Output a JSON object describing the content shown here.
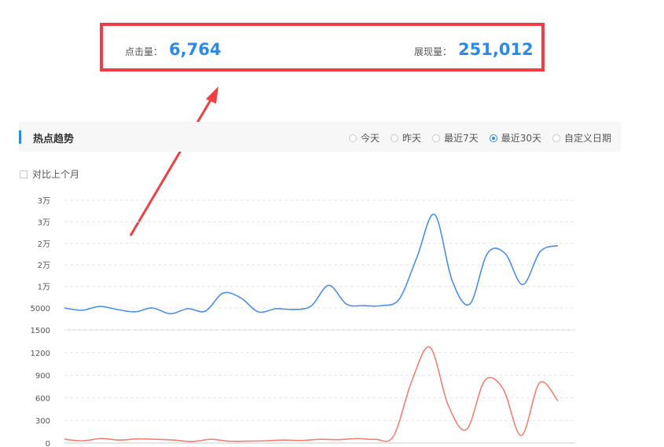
{
  "stats": {
    "clicks": {
      "label": "点击量：",
      "value": "6,764"
    },
    "impressions": {
      "label": "展现量：",
      "value": "251,012"
    }
  },
  "trend": {
    "title": "热点趋势",
    "ranges": [
      {
        "label": "今天",
        "checked": false
      },
      {
        "label": "昨天",
        "checked": false
      },
      {
        "label": "最近7天",
        "checked": false
      },
      {
        "label": "最近30天",
        "checked": true
      },
      {
        "label": "自定义日期",
        "checked": false
      }
    ],
    "compare_label": "对比上个月"
  },
  "colors": {
    "accent": "#2b8ae6",
    "impressions_line": "#4a8ee6",
    "clicks_line": "#f28072",
    "highlight_border": "#f03f44"
  },
  "chart_data": [
    {
      "type": "line",
      "y_tick_labels": [
        "5000",
        "1万",
        "2万",
        "2万",
        "3万",
        "3万"
      ],
      "ylim": [
        3000,
        30000
      ],
      "series": [
        {
          "color": "#4a8ee6",
          "values": [
            5000,
            4400,
            5400,
            4600,
            4000,
            5000,
            3500,
            4800,
            4200,
            8800,
            7600,
            4000,
            4800,
            4600,
            5500,
            10800,
            6000,
            5600,
            5600,
            7300,
            18000,
            29000,
            12000,
            6000,
            19000,
            19000,
            11000,
            19500,
            21000
          ]
        }
      ]
    },
    {
      "type": "line",
      "y_tick_labels": [
        "0",
        "300",
        "600",
        "900",
        "1200",
        "1500"
      ],
      "ylim": [
        0,
        1500
      ],
      "series": [
        {
          "color": "#f28072",
          "values": [
            50,
            30,
            60,
            40,
            55,
            50,
            40,
            20,
            50,
            25,
            25,
            30,
            40,
            35,
            50,
            45,
            60,
            50,
            90,
            820,
            1270,
            500,
            180,
            830,
            720,
            100,
            800,
            560
          ]
        }
      ]
    }
  ]
}
